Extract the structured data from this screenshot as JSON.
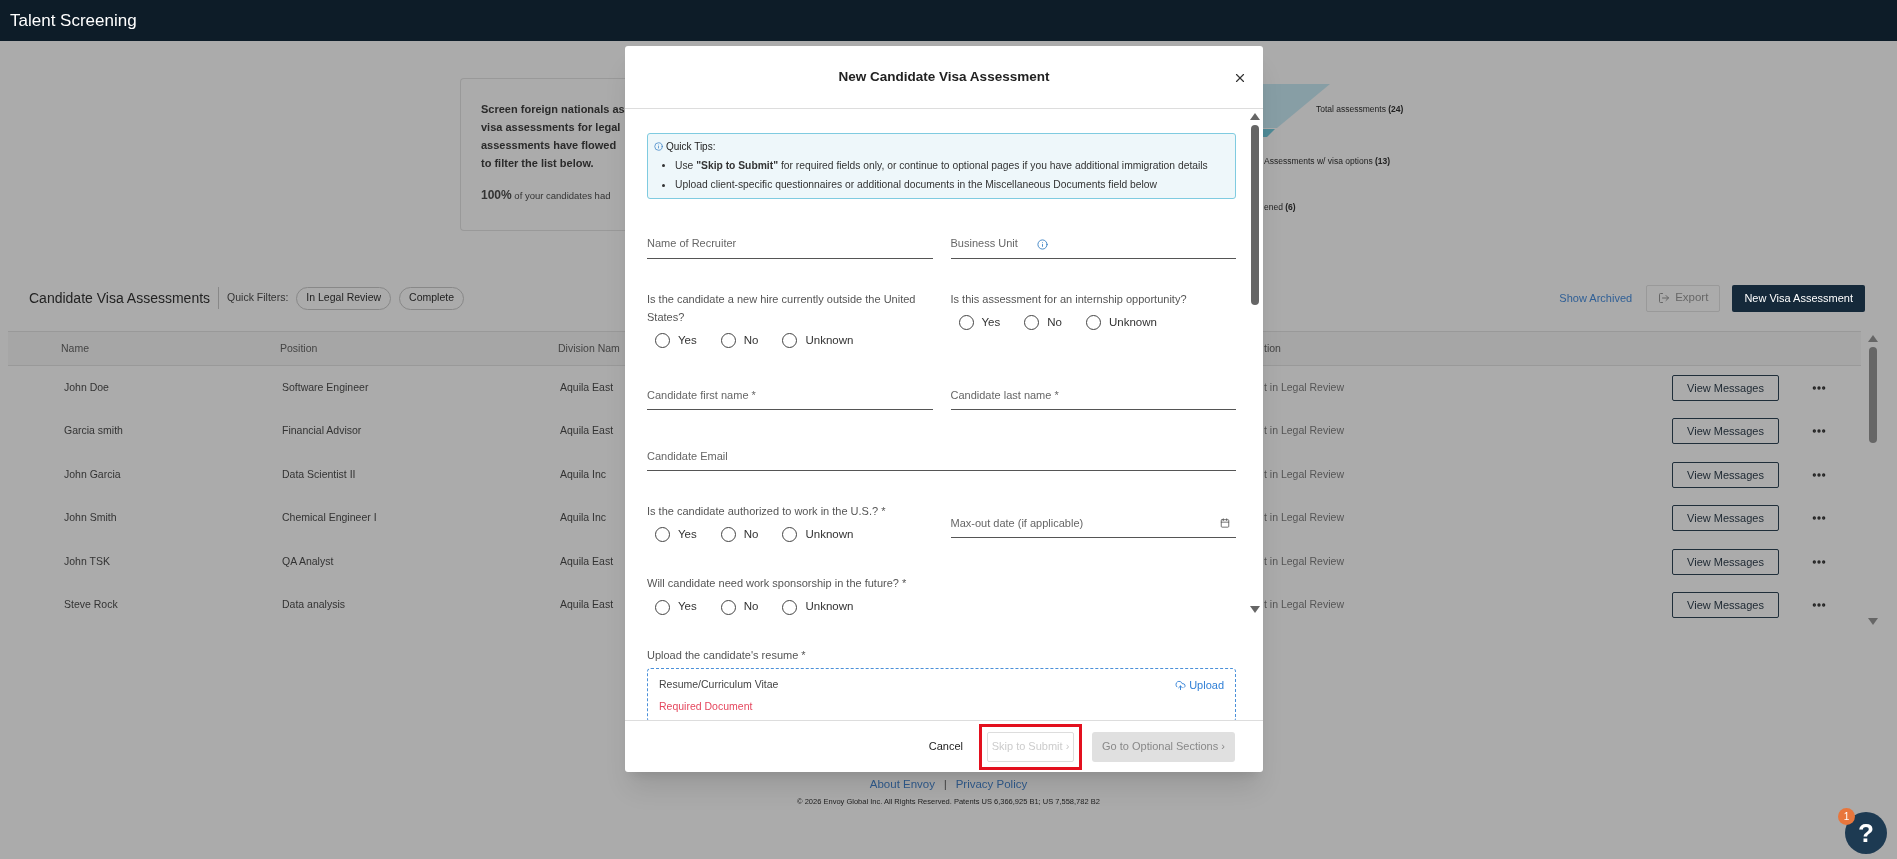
{
  "app_bar": {
    "title": "Talent Screening"
  },
  "summary": {
    "lines": [
      "Screen foreign nationals as",
      "visa assessments for legal",
      "assessments have flowed",
      "to filter the list below."
    ],
    "stat": "**100%** of your candidates had"
  },
  "chart_legend": [
    "Total assessments **(24)**",
    "Assessments w/ visa options **(13)**",
    "ened **(6)**"
  ],
  "assessments": {
    "title": "Candidate Visa Assessments",
    "filters_label": "Quick Filters:",
    "filters": [
      "In Legal Review",
      "Complete"
    ],
    "show_archived": "Show Archived",
    "export": {
      "label": "Export",
      "disabled": true
    },
    "new_button": "New Visa Assessment",
    "columns": [
      "Name",
      "Position",
      "Division Nam"
    ],
    "right_column": "tion",
    "rows": [
      {
        "name": "John Doe",
        "position": "Software Engineer",
        "division": "Aquila East",
        "status": "t in Legal Review",
        "action": "View Messages"
      },
      {
        "name": "Garcia smith",
        "position": "Financial Advisor",
        "division": "Aquila East",
        "status": "t in Legal Review",
        "action": "View Messages"
      },
      {
        "name": "John Garcia",
        "position": "Data Scientist II",
        "division": "Aquila Inc",
        "status": "t in Legal Review",
        "action": "View Messages"
      },
      {
        "name": "John Smith",
        "position": "Chemical Engineer I",
        "division": "Aquila Inc",
        "status": "t in Legal Review",
        "action": "View Messages"
      },
      {
        "name": "John TSK",
        "position": "QA Analyst",
        "division": "Aquila East",
        "status": "t in Legal Review",
        "action": "View Messages"
      },
      {
        "name": "Steve Rock",
        "position": "Data analysis",
        "division": "Aquila East",
        "status": "t in Legal Review",
        "action": "View Messages"
      }
    ]
  },
  "footer": {
    "links": [
      "About Envoy",
      "Privacy Policy"
    ],
    "separator": "|",
    "copyright": "© 2026 Envoy Global Inc. All Rights Reserved. Patents US 6,366,925 B1; US 7,558,782 B2"
  },
  "help": {
    "label": "?",
    "badge": "1"
  },
  "modal": {
    "title": "New Candidate Visa Assessment",
    "tips": {
      "heading": "Quick Tips:",
      "items": [
        "Use **\"Skip to Submit\"** for required fields only, or continue to optional pages if you have additional immigration details",
        "Upload client-specific questionnaires or additional documents in the Miscellaneous Documents field below"
      ]
    },
    "rows": [
      {
        "items": [
          {
            "kind": "text",
            "placeholder": "Name of Recruiter"
          },
          {
            "kind": "text",
            "placeholder": "Business Unit",
            "info": true
          }
        ]
      },
      {
        "items": [
          {
            "kind": "radio",
            "label": "Is the candidate a new hire currently outside the United States?",
            "options": [
              {
                "label": "Yes",
                "selected": false
              },
              {
                "label": "No",
                "selected": false
              },
              {
                "label": "Unknown",
                "selected": false
              }
            ]
          },
          {
            "kind": "radio",
            "label": "Is this assessment for an internship opportunity?",
            "options": [
              {
                "label": "Yes",
                "selected": false
              },
              {
                "label": "No",
                "selected": false
              },
              {
                "label": "Unknown",
                "selected": false
              }
            ]
          }
        ]
      },
      {
        "items": [
          {
            "kind": "text",
            "placeholder": "Candidate first name *"
          },
          {
            "kind": "text",
            "placeholder": "Candidate last name *"
          }
        ]
      },
      {
        "items": [
          {
            "kind": "text",
            "placeholder": "Candidate Email",
            "wide": true
          }
        ]
      },
      {
        "items": [
          {
            "kind": "radio",
            "label": "Is the candidate authorized to work in the U.S.? *",
            "options": [
              {
                "label": "Yes",
                "selected": false
              },
              {
                "label": "No",
                "selected": false
              },
              {
                "label": "Unknown",
                "selected": false
              }
            ]
          },
          {
            "kind": "date",
            "placeholder": "Max-out date (if applicable)"
          }
        ]
      },
      {
        "items": [
          {
            "kind": "radio",
            "label": "Will candidate need work sponsorship in the future? *",
            "options": [
              {
                "label": "Yes",
                "selected": false
              },
              {
                "label": "No",
                "selected": false
              },
              {
                "label": "Unknown",
                "selected": false
              }
            ]
          }
        ]
      },
      {
        "items": [
          {
            "kind": "upload",
            "label": "Upload the candidate's resume *",
            "document": "Resume/Curriculum Vitae",
            "status": "Required Document",
            "action": "Upload",
            "wide": true
          }
        ]
      }
    ],
    "buttons": [
      {
        "kind": "text",
        "label": "Cancel",
        "disabled": false,
        "highlighted": false
      },
      {
        "kind": "outline",
        "label": "Skip to Submit ›",
        "disabled": true,
        "highlighted": true
      },
      {
        "kind": "filled",
        "label": "Go to Optional Sections ›",
        "disabled": true,
        "highlighted": false
      }
    ]
  }
}
